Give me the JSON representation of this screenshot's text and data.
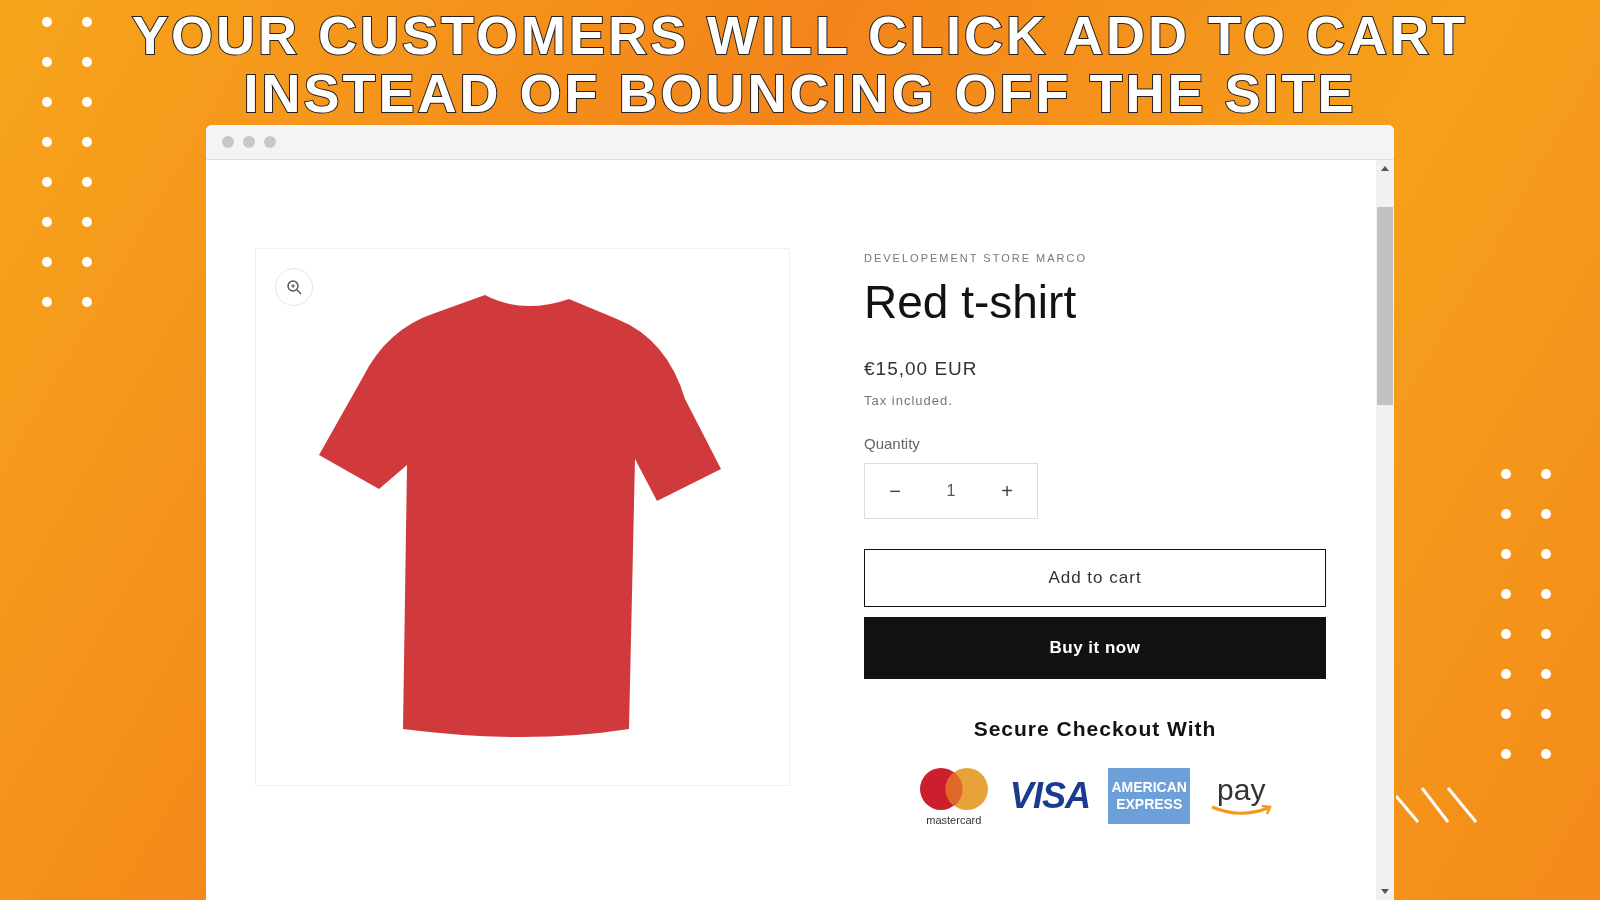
{
  "headline": [
    "YOUR CUSTOMERS WILL CLICK ADD TO CART",
    "INSTEAD OF BOUNCING OFF THE SITE"
  ],
  "product": {
    "vendor": "DEVELOPEMENT STORE MARCO",
    "title": "Red t-shirt",
    "price": "€15,00 EUR",
    "tax_note": "Tax included.",
    "quantity_label": "Quantity",
    "quantity": "1",
    "decrease": "−",
    "increase": "+",
    "add_to_cart": "Add to cart",
    "buy_now": "Buy it now",
    "secure_heading": "Secure Checkout With",
    "payment_logos": [
      {
        "kind": "mastercard",
        "text": "mastercard"
      },
      {
        "kind": "visa",
        "text": "VISA"
      },
      {
        "kind": "amex",
        "text": "AMERICAN EXPRESS"
      },
      {
        "kind": "amazon",
        "text": "pay"
      }
    ]
  }
}
